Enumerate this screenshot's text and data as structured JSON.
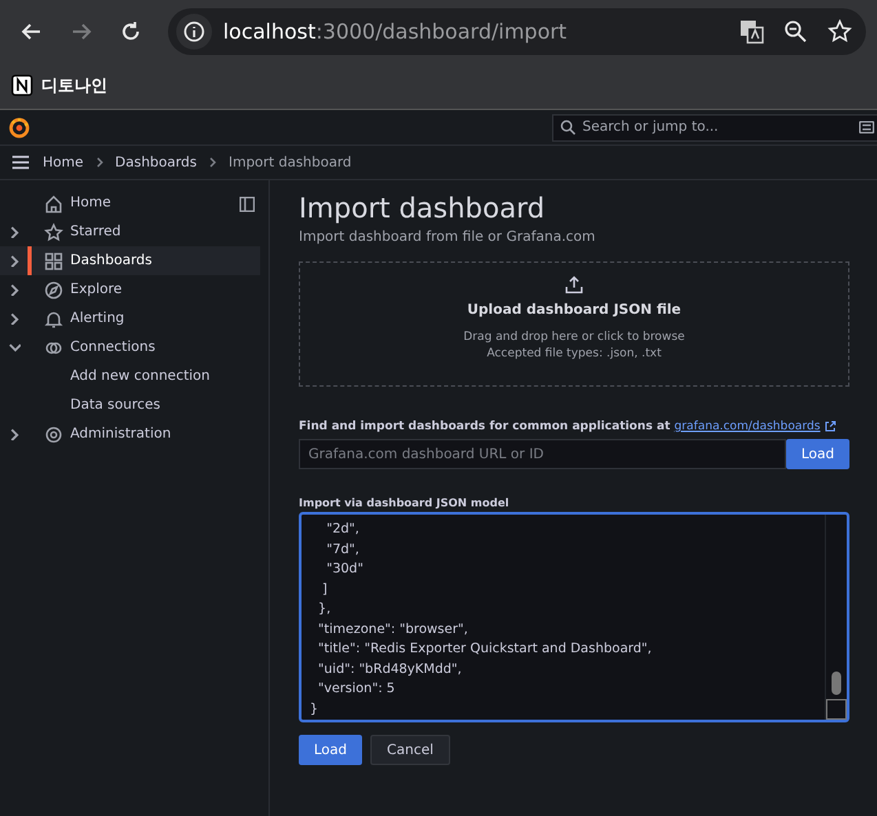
{
  "browser": {
    "url_host": "localhost",
    "url_path": ":3000/dashboard/import",
    "bookmarks": [
      {
        "label": "디토나인"
      }
    ]
  },
  "topbar": {
    "search_placeholder": "Search or jump to..."
  },
  "breadcrumbs": [
    {
      "label": "Home",
      "selected": false
    },
    {
      "label": "Dashboards",
      "selected": false
    },
    {
      "label": "Import dashboard",
      "selected": true
    }
  ],
  "sidebar": {
    "items": [
      {
        "label": "Home",
        "expandable": false,
        "selected": false
      },
      {
        "label": "Starred",
        "expandable": true,
        "expanded": false,
        "selected": false
      },
      {
        "label": "Dashboards",
        "expandable": true,
        "expanded": false,
        "selected": true
      },
      {
        "label": "Explore",
        "expandable": true,
        "expanded": false,
        "selected": false
      },
      {
        "label": "Alerting",
        "expandable": true,
        "expanded": false,
        "selected": false
      },
      {
        "label": "Connections",
        "expandable": true,
        "expanded": true,
        "selected": false,
        "children": [
          {
            "label": "Add new connection",
            "selected": false
          },
          {
            "label": "Data sources",
            "selected": false
          }
        ]
      },
      {
        "label": "Administration",
        "expandable": true,
        "expanded": false,
        "selected": false
      }
    ]
  },
  "page": {
    "title": "Import dashboard",
    "subtitle": "Import dashboard from file or Grafana.com",
    "upload": {
      "title": "Upload dashboard JSON file",
      "hint": "Drag and drop here or click to browse",
      "types": "Accepted file types: .json, .txt"
    },
    "grafana_com": {
      "label": "Find and import dashboards for common applications at",
      "link": "grafana.com/dashboards",
      "placeholder": "Grafana.com dashboard URL or ID",
      "button": "Load"
    },
    "json_model": {
      "label": "Import via dashboard JSON model",
      "lines": [
        "    \"2d\",",
        "    \"7d\",",
        "    \"30d\"",
        "   ]",
        "  },",
        "  \"timezone\": \"browser\",",
        "  \"title\": \"Redis Exporter Quickstart and Dashboard\",",
        "  \"uid\": \"bRd48yKMdd\",",
        "  \"version\": 5",
        "}"
      ]
    },
    "buttons": [
      {
        "label": "Load",
        "kind": "primary"
      },
      {
        "label": "Cancel",
        "kind": "secondary"
      }
    ]
  }
}
